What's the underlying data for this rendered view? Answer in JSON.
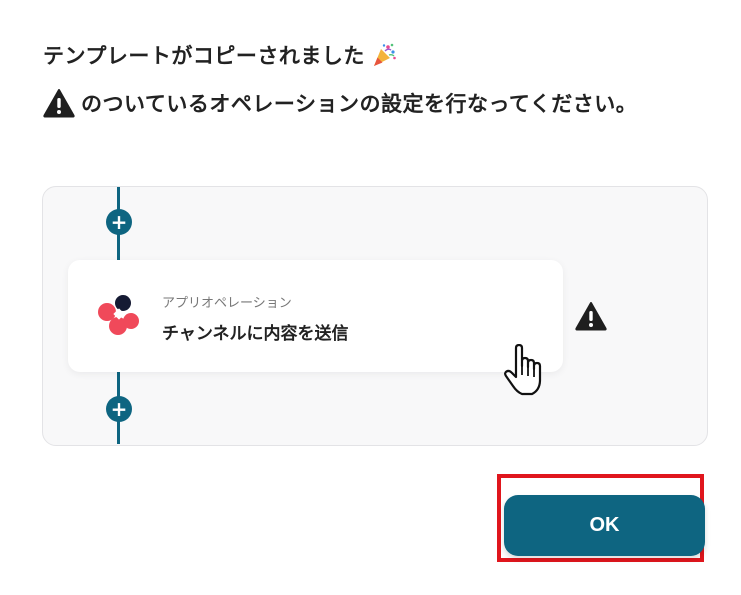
{
  "dialog": {
    "title_line1": "テンプレートがコピーされました",
    "title_line2": "のついているオペレーションの設定を行なってください。"
  },
  "flow": {
    "card": {
      "subtitle": "アプリオペレーション",
      "title": "チャンネルに内容を送信"
    },
    "add_step_label": "+"
  },
  "actions": {
    "ok_label": "OK"
  },
  "colors": {
    "accent": "#0e6581",
    "highlight": "#e0161d",
    "warning": "#1f1f1f",
    "logo_red": "#f0495a",
    "logo_dark": "#151a33"
  },
  "icons": [
    "party-popper-icon",
    "warning-icon",
    "app-logo-icon",
    "plus-icon",
    "hand-pointer-icon"
  ]
}
